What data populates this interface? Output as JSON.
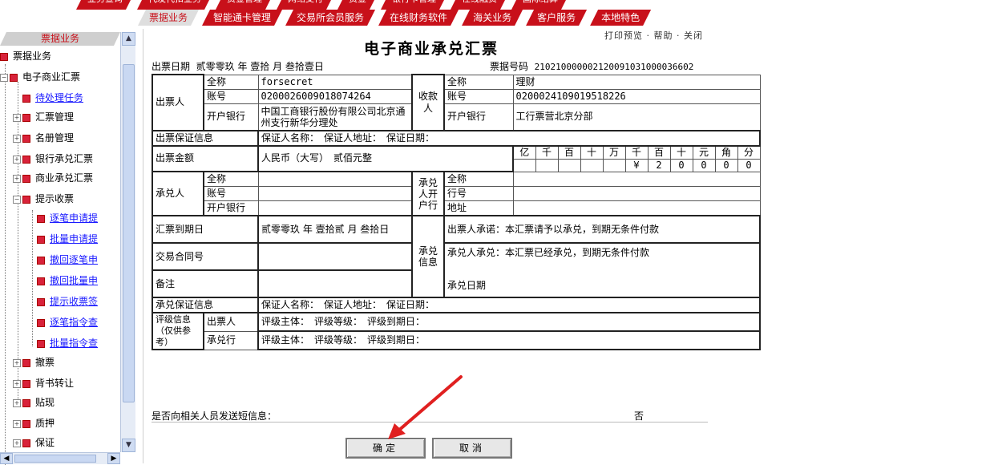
{
  "nav": {
    "row1": [
      "业务查询",
      "代发代扣业务",
      "资金管理",
      "网络支付",
      "资金",
      "银行卡管理",
      "在线融资",
      "国际结算"
    ],
    "row2": [
      "票据业务",
      "智能通卡管理",
      "交易所会员服务",
      "在线财务软件",
      "海关业务",
      "客户服务",
      "本地特色"
    ]
  },
  "sidebar": {
    "header": "票据业务",
    "items": [
      {
        "label": "票据业务"
      },
      {
        "label": "电子商业汇票"
      },
      {
        "label": "待处理任务"
      },
      {
        "label": "汇票管理"
      },
      {
        "label": "名册管理"
      },
      {
        "label": "银行承兑汇票"
      },
      {
        "label": "商业承兑汇票"
      },
      {
        "label": "提示收票"
      },
      {
        "label": "逐笔申请提"
      },
      {
        "label": "批量申请提"
      },
      {
        "label": "撤回逐笔申"
      },
      {
        "label": "撤回批量申"
      },
      {
        "label": "提示收票签"
      },
      {
        "label": "逐笔指令查"
      },
      {
        "label": "批量指令查"
      },
      {
        "label": "撤票"
      },
      {
        "label": "背书转让"
      },
      {
        "label": "贴现"
      },
      {
        "label": "质押"
      },
      {
        "label": "保证"
      }
    ]
  },
  "main": {
    "top_links": "打印预览 · 帮助 · 关闭",
    "title": "电子商业承兑汇票",
    "issue_date_label": "出票日期",
    "issue_date": "贰零零玖 年 壹拾 月 叁拾壹日",
    "bill_no_label": "票据号码",
    "bill_no": "210210000002120091031000036602",
    "drawer": {
      "section": "出票人",
      "name_label": "全称",
      "name": "forsecret",
      "account_label": "账号",
      "account": "0200026009018074264",
      "bank_label": "开户银行",
      "bank": "中国工商银行股份有限公司北京通州支行新华分理处"
    },
    "payee": {
      "section": "收款人",
      "name_label": "全称",
      "name": "理财",
      "account_label": "账号",
      "account": "0200024109019518226",
      "bank_label": "开户银行",
      "bank": "工行票营北京分部"
    },
    "guarantee": {
      "label": "出票保证信息",
      "text": "保证人名称：　保证人地址：　保证日期："
    },
    "amount": {
      "label": "出票金额",
      "words": "人民币（大写）　贰佰元整",
      "units": [
        "亿",
        "千",
        "百",
        "十",
        "万",
        "千",
        "百",
        "十",
        "元",
        "角",
        "分"
      ],
      "digits": [
        "",
        "",
        "",
        "",
        "",
        "¥",
        "2",
        "0",
        "0",
        "0",
        "0"
      ]
    },
    "acceptor": {
      "section": "承兑人",
      "name_label": "全称",
      "account_label": "账号",
      "bank_label": "开户银行",
      "bank_section": "承兑人开户行",
      "rows": [
        "全称",
        "行号",
        "地址"
      ]
    },
    "due_date": {
      "label": "汇票到期日",
      "value": "贰零零玖 年 壹拾贰 月 叁拾日"
    },
    "contract": {
      "label": "交易合同号",
      "value": ""
    },
    "remark": {
      "label": "备注",
      "value": ""
    },
    "accept_info": {
      "label": "承兑信息",
      "drawer_promise": "出票人承诺：本汇票请予以承兑，到期无条件付款",
      "acceptor_promise": "承兑人承兑：本汇票已经承兑，到期无条件付款",
      "accept_date": "承兑日期"
    },
    "accept_guarantee": {
      "label": "承兑保证信息",
      "text": "保证人名称：　保证人地址：　保证日期："
    },
    "rating": {
      "label": "评级信息（仅供参考）",
      "drawer_label": "出票人",
      "acceptor_label": "承兑行",
      "text": "评级主体：　评级等级：　评级到期日："
    },
    "notify_label": "是否向相关人员发送短信息：",
    "notify_value": "否",
    "confirm": "确定",
    "cancel": "取消"
  },
  "colors": {
    "brand_red": "#c8101a",
    "annotation_arrow": "#e02020"
  }
}
